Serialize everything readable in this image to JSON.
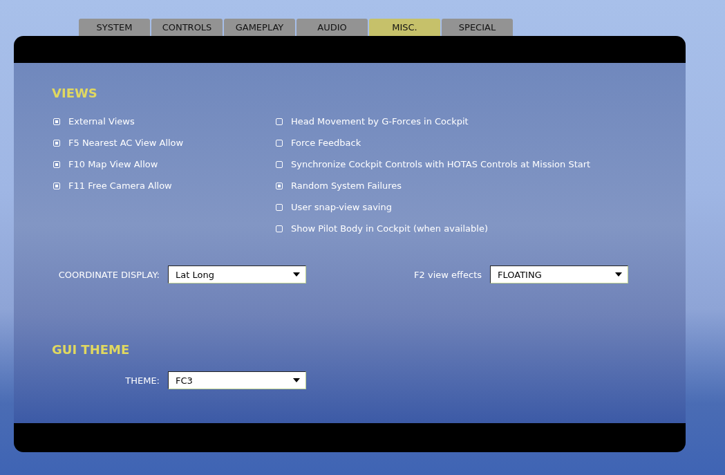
{
  "tabs": [
    {
      "label": "SYSTEM",
      "selected": false
    },
    {
      "label": "CONTROLS",
      "selected": false
    },
    {
      "label": "GAMEPLAY",
      "selected": false
    },
    {
      "label": "AUDIO",
      "selected": false
    },
    {
      "label": "MISC.",
      "selected": true
    },
    {
      "label": "SPECIAL",
      "selected": false
    }
  ],
  "views": {
    "heading": "VIEWS",
    "left_options": [
      {
        "label": "External Views",
        "checked": true
      },
      {
        "label": "F5 Nearest AC View Allow",
        "checked": true
      },
      {
        "label": "F10 Map View Allow",
        "checked": true
      },
      {
        "label": "F11 Free Camera Allow",
        "checked": true
      }
    ],
    "right_options": [
      {
        "label": "Head Movement by G-Forces in Cockpit",
        "checked": false
      },
      {
        "label": "Force Feedback",
        "checked": false
      },
      {
        "label": "Synchronize Cockpit Controls with HOTAS Controls at Mission Start",
        "checked": false
      },
      {
        "label": "Random System Failures",
        "checked": true
      },
      {
        "label": "User snap-view saving",
        "checked": false
      },
      {
        "label": "Show Pilot Body in Cockpit (when available)",
        "checked": false
      }
    ],
    "coordinate_display": {
      "label": "COORDINATE DISPLAY:",
      "value": "Lat Long"
    },
    "f2_view_effects": {
      "label": "F2 view effects",
      "value": "FLOATING"
    }
  },
  "gui_theme": {
    "heading": "GUI THEME",
    "theme": {
      "label": "THEME:",
      "value": "FC3"
    }
  }
}
